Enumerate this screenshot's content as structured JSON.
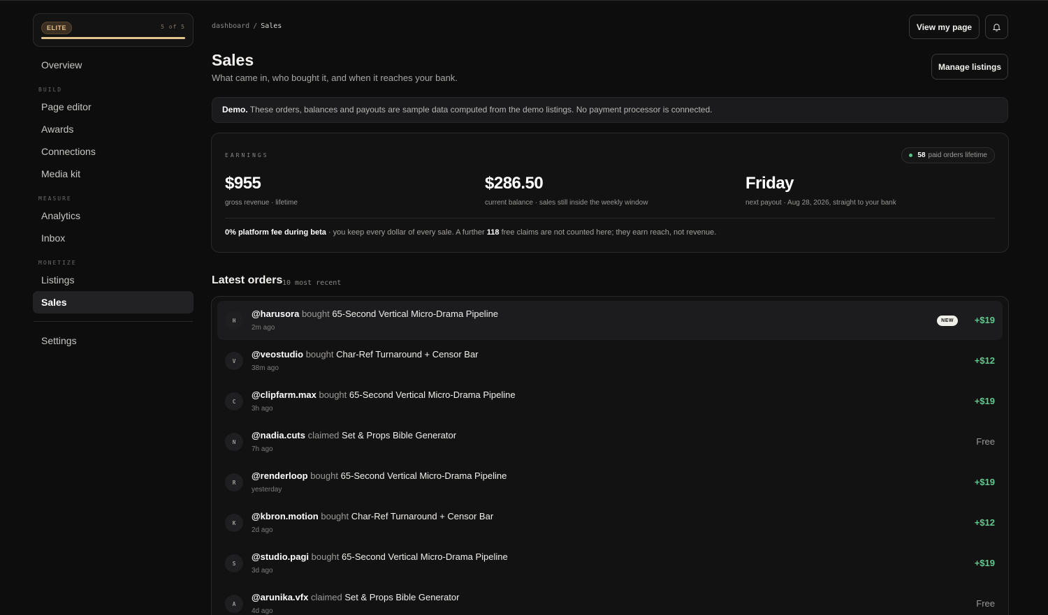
{
  "sidebar": {
    "tier_badge": "ELITE",
    "tier_count": "5 of 5",
    "tier_progress": 1.0,
    "overview": "Overview",
    "section_build": "BUILD",
    "page_editor": "Page editor",
    "awards": "Awards",
    "connections": "Connections",
    "media_kit": "Media kit",
    "section_measure": "MEASURE",
    "analytics": "Analytics",
    "inbox": "Inbox",
    "section_monetize": "MONETIZE",
    "listings": "Listings",
    "sales": "Sales",
    "settings": "Settings",
    "active_item": "Sales"
  },
  "header": {
    "breadcrumb_root": "dashboard",
    "breadcrumb_sep": "/",
    "breadcrumb_current": "Sales",
    "view_my_page": "View my page",
    "bell_icon": "bell-icon",
    "manage_listings": "Manage listings",
    "title": "Sales",
    "subtitle": "What came in, who bought it, and when it reaches your bank."
  },
  "banner": {
    "bold": "Demo.",
    "text": " These orders, balances and payouts are sample data computed from the demo listings. No payment processor is connected."
  },
  "earnings": {
    "label": "EARNINGS",
    "paid_orders_count": "58",
    "paid_orders_text": "paid orders lifetime",
    "gross_value": "$955",
    "gross_caption": "gross revenue · lifetime",
    "balance_value": "$286.50",
    "balance_caption": "current balance · sales still inside the weekly window",
    "payout_value": "Friday",
    "payout_caption": "next payout · Aug 28, 2026, straight to your bank",
    "footer_bold": "0% platform fee during beta",
    "footer_text_1": " · you keep every dollar of every sale. A further ",
    "footer_free_count": "118",
    "footer_text_2": " free claims are not counted here; they earn reach, not revenue."
  },
  "orders": {
    "title": "Latest orders",
    "subtitle": "10 most recent",
    "new_badge": "NEW",
    "rows": [
      {
        "initial": "H",
        "user": "@harusora",
        "verb": "bought",
        "item": "65-Second Vertical Micro-Drama Pipeline",
        "time": "2m ago",
        "amount": "+$19",
        "free": false
      },
      {
        "initial": "V",
        "user": "@veostudio",
        "verb": "bought",
        "item": "Char-Ref Turnaround + Censor Bar",
        "time": "38m ago",
        "amount": "+$12",
        "free": false
      },
      {
        "initial": "C",
        "user": "@clipfarm.max",
        "verb": "bought",
        "item": "65-Second Vertical Micro-Drama Pipeline",
        "time": "3h ago",
        "amount": "+$19",
        "free": false
      },
      {
        "initial": "N",
        "user": "@nadia.cuts",
        "verb": "claimed",
        "item": "Set & Props Bible Generator",
        "time": "7h ago",
        "amount": "Free",
        "free": true
      },
      {
        "initial": "R",
        "user": "@renderloop",
        "verb": "bought",
        "item": "65-Second Vertical Micro-Drama Pipeline",
        "time": "yesterday",
        "amount": "+$19",
        "free": false
      },
      {
        "initial": "K",
        "user": "@kbron.motion",
        "verb": "bought",
        "item": "Char-Ref Turnaround + Censor Bar",
        "time": "2d ago",
        "amount": "+$12",
        "free": false
      },
      {
        "initial": "S",
        "user": "@studio.pagi",
        "verb": "bought",
        "item": "65-Second Vertical Micro-Drama Pipeline",
        "time": "3d ago",
        "amount": "+$19",
        "free": false
      },
      {
        "initial": "A",
        "user": "@arunika.vfx",
        "verb": "claimed",
        "item": "Set & Props Bible Generator",
        "time": "4d ago",
        "amount": "Free",
        "free": true
      }
    ]
  },
  "colors": {
    "background": "#0d0d0e",
    "accent_gold": "#e3c48f",
    "positive_green": "#61c98d"
  }
}
